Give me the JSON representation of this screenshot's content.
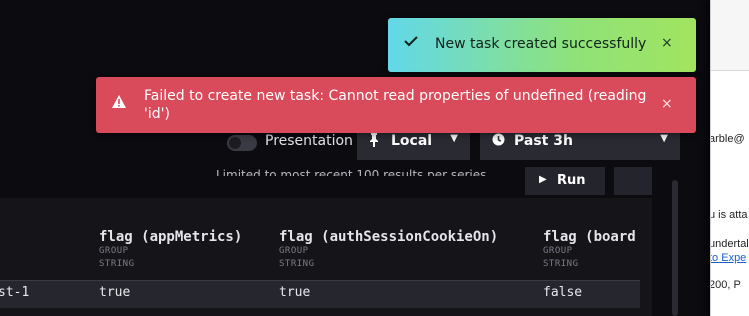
{
  "toasts": {
    "success": {
      "message": "New task created successfully",
      "icon": "check-icon",
      "close": "×"
    },
    "error": {
      "message": "Failed to create new task: Cannot read properties of undefined (reading 'id')",
      "icon": "warning-icon",
      "close": "×"
    }
  },
  "toolbar": {
    "presentation_label": "Presentation",
    "presentation_on": false,
    "source": {
      "icon": "pin-icon",
      "label": "Local"
    },
    "time_range": {
      "icon": "clock-icon",
      "label": "Past 3h"
    }
  },
  "panel": {
    "limit_note": "Limited to most recent 100 results per series",
    "run_label": "Run"
  },
  "table": {
    "columns": [
      {
        "name": "flag (appMetrics)",
        "group": "GROUP",
        "type": "STRING"
      },
      {
        "name": "flag (authSessionCookieOn)",
        "group": "GROUP",
        "type": "STRING"
      },
      {
        "name": "flag (board",
        "group": "GROUP",
        "type": "STRING"
      }
    ],
    "row": {
      "first": "st-1",
      "values": [
        "true",
        "true",
        "false"
      ]
    }
  },
  "right_window": {
    "lines": [
      "arble@",
      "u is atta",
      "undertal",
      "to Expe",
      "200, P"
    ]
  },
  "colors": {
    "success_start": "#62d8ea",
    "success_end": "#a1e45f",
    "error": "#d94a5b",
    "background": "#0b0b10",
    "control": "#2a2a33"
  }
}
